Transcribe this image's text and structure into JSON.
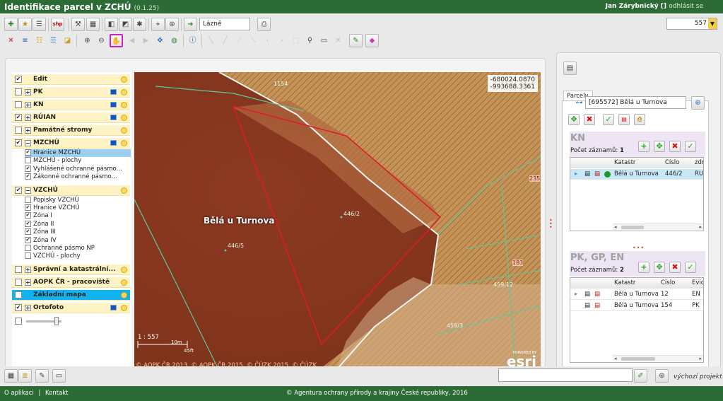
{
  "app": {
    "title": "Identifikace parcel v ZCHÚ",
    "version": "(0.1.25)",
    "user": "Jan Zárybnický",
    "user_bracket": "[]",
    "logout": "odhlásit se"
  },
  "toolbar": {
    "place_field": "Lázně",
    "scale_value": "557",
    "shp_label": "shp"
  },
  "layers": {
    "groups": [
      {
        "label": "Edit",
        "checked": true
      },
      {
        "label": "PK",
        "checked": false
      },
      {
        "label": "KN",
        "checked": false
      },
      {
        "label": "RÚIAN",
        "checked": true
      },
      {
        "label": "Památné stromy",
        "checked": false
      },
      {
        "label": "MZCHÚ",
        "checked": true
      },
      {
        "label": "VZCHÚ",
        "checked": true
      },
      {
        "label": "Správní a katastrální...",
        "checked": false
      },
      {
        "label": "AOPK ČR - pracoviště",
        "checked": false
      },
      {
        "label": "Základní mapa",
        "checked": false
      },
      {
        "label": "Ortofoto",
        "checked": true
      }
    ],
    "mzchu_items": [
      "Hranice MZCHÚ",
      "MZCHÚ - plochy",
      "Vyhlášené ochranné pásmo...",
      "Zákonné ochranné pásmo..."
    ],
    "vzchu_items": [
      "Popisky VZCHÚ",
      "Hranice VZCHÚ",
      "Zóna I",
      "Zóna II",
      "Zóna III",
      "Zóna IV",
      "Ochranné pásmo NP",
      "VZCHÚ - plochy"
    ],
    "mzchu_checked": [
      true,
      false,
      true,
      true
    ],
    "vzchu_checked": [
      false,
      true,
      true,
      true,
      true,
      true,
      false,
      false
    ]
  },
  "map": {
    "coord_x": "-680024.0870",
    "coord_y": "-993688.3361",
    "place_name": "Bělá u Turnova",
    "parcels": [
      "1154",
      "446/2",
      "446/5",
      "235",
      "183",
      "459/12",
      "459/3"
    ],
    "scale_text": "1 : 557",
    "scale_bar_top": "10m",
    "scale_bar_bottom": "45ft",
    "copyright": "© AOPK ČR 2013, © AOPK ČR 2015, © ČÚZK 2015, © ČÚZK",
    "esri_powered": "POWERED BY",
    "esri_logo": "esri"
  },
  "right": {
    "tab": "Parcely",
    "ku_select": "[695572] Bělá u Turnova",
    "kn": {
      "title": "KN",
      "count_label": "Počet záznamů:",
      "count": "1",
      "columns": [
        "",
        "Katastr",
        "Číslo",
        "zdr"
      ],
      "rows": [
        {
          "katastr": "Bělá u Turnova",
          "cislo": "446/2",
          "zdroj": "RÚ"
        }
      ]
    },
    "pk": {
      "title": "PK, GP, EN",
      "count_label": "Počet záznamů:",
      "count": "2",
      "columns": [
        "",
        "Katastr",
        "Číslo",
        "Evid"
      ],
      "rows": [
        {
          "katastr": "Bělá u Turnova",
          "cislo": "12",
          "evid": "EN"
        },
        {
          "katastr": "Bělá u Turnova",
          "cislo": "154",
          "evid": "PK"
        }
      ]
    }
  },
  "bottom": {
    "search_value": "",
    "default_project": "výchozí projekt"
  },
  "footer": {
    "about": "O aplikaci",
    "separator": "|",
    "contact": "Kontakt",
    "copyright": "© Agentura ochrany přírody a krajiny České republiky, 2016"
  },
  "colors": {
    "header_green": "#2c6b36",
    "map_brown": "#8a3820",
    "layer_group_bg": "#fdf3c4",
    "selection_blue": "#10b2f0",
    "parcel_outline": "#e01828"
  }
}
